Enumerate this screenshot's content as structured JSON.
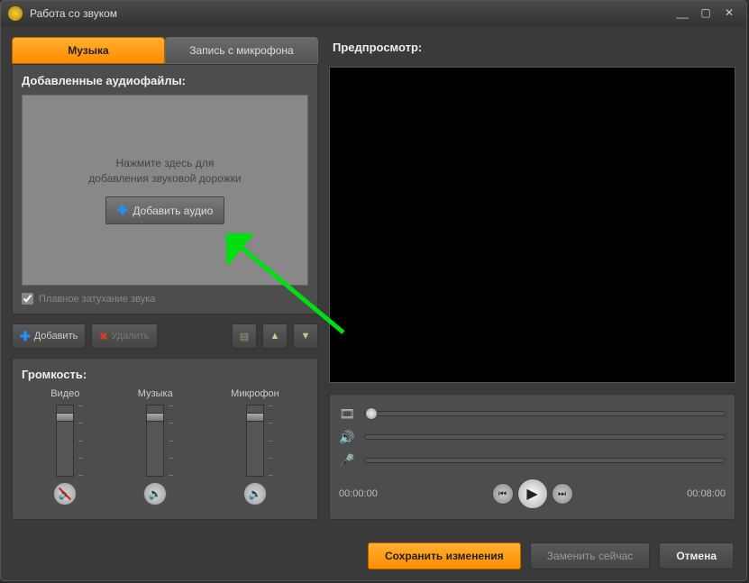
{
  "window": {
    "title": "Работа со звуком"
  },
  "tabs": [
    {
      "label": "Музыка",
      "active": true
    },
    {
      "label": "Запись с микрофона",
      "active": false
    }
  ],
  "audio_panel": {
    "title": "Добавленные аудиофайлы:",
    "hint_line1": "Нажмите здесь для",
    "hint_line2": "добавления звуковой дорожки",
    "add_button": "Добавить аудио",
    "fade_label": "Плавное затухание звука",
    "fade_checked": true
  },
  "toolbar": {
    "add": "Добавить",
    "delete": "Удалить"
  },
  "volume": {
    "title": "Громкость:",
    "cols": [
      {
        "label": "Видео",
        "muted": true
      },
      {
        "label": "Музыка",
        "muted": false
      },
      {
        "label": "Микрофон",
        "muted": false
      }
    ]
  },
  "preview": {
    "title": "Предпросмотр:",
    "time_current": "00:00:00",
    "time_total": "00:08:00"
  },
  "footer": {
    "save": "Сохранить изменения",
    "replace": "Заменить сейчас",
    "cancel": "Отмена"
  },
  "colors": {
    "accent": "#ff8c00",
    "bg": "#3a3a3a",
    "panel": "#4d4d4d"
  }
}
